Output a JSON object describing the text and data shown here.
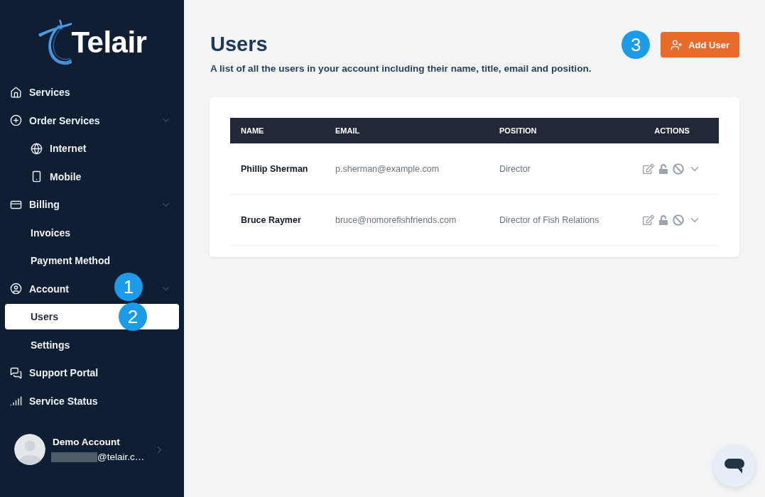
{
  "logo": {
    "text": "Telair"
  },
  "sidebar": {
    "items": [
      {
        "label": "Services",
        "selected": false
      },
      {
        "label": "Order Services",
        "selected": false,
        "expanded": true,
        "children": [
          {
            "label": "Internet",
            "selected": false
          },
          {
            "label": "Mobile",
            "selected": false
          }
        ]
      },
      {
        "label": "Billing",
        "selected": false,
        "expanded": true,
        "children": [
          {
            "label": "Invoices",
            "selected": false
          },
          {
            "label": "Payment Method",
            "selected": false
          }
        ]
      },
      {
        "label": "Account",
        "selected": false,
        "expanded": true,
        "callout": "1",
        "children": [
          {
            "label": "Users",
            "selected": true,
            "callout": "2"
          },
          {
            "label": "Settings",
            "selected": false
          }
        ]
      },
      {
        "label": "Support Portal",
        "selected": false
      },
      {
        "label": "Service Status",
        "selected": false
      }
    ],
    "account": {
      "name": "Demo Account",
      "email": "@telair.c…",
      "email_redacted": true
    }
  },
  "page": {
    "title": "Users",
    "subtitle": "A list of all the users in your account including their name, title, email and position.",
    "add_button": {
      "label": "Add User",
      "callout": "3"
    }
  },
  "table": {
    "columns": [
      "NAME",
      "EMAIL",
      "POSITION",
      "ACTIONS"
    ],
    "rows": [
      {
        "name": "Phillip Sherman",
        "email": "p.sherman@example.com",
        "position": "Director"
      },
      {
        "name": "Bruce Raymer",
        "email": "bruce@nomorefishfriends.com",
        "position": "Director of Fish Relations"
      }
    ]
  }
}
